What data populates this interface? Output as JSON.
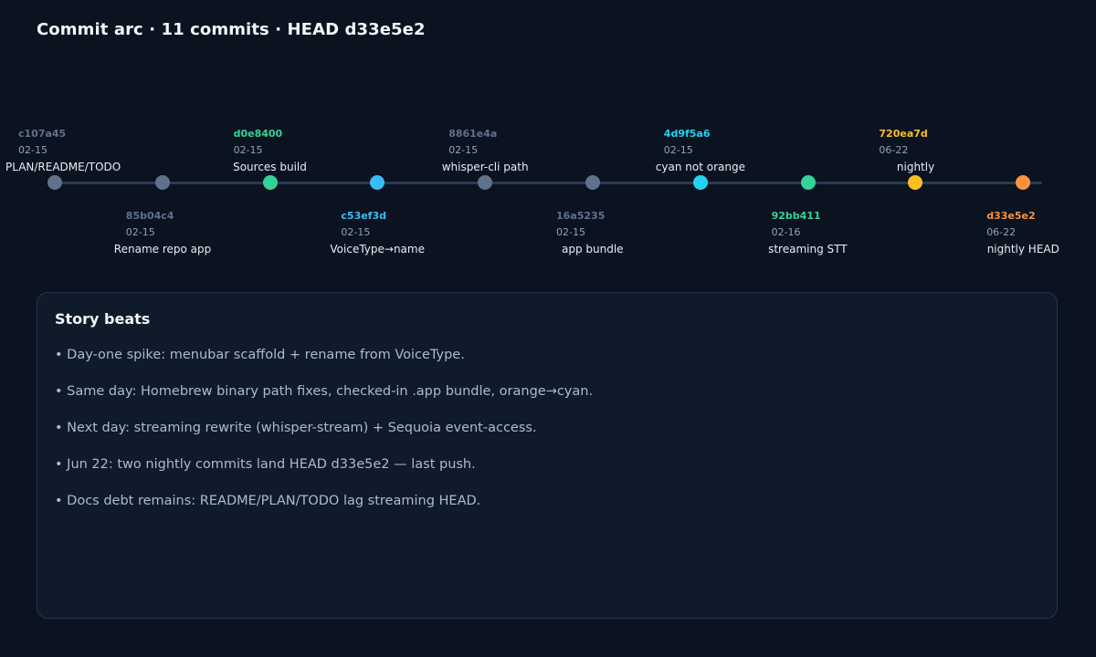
{
  "header": {
    "title": "Commit arc · 11 commits · HEAD d33e5e2"
  },
  "commits": [
    {
      "hash": "c107a45",
      "date": "02-15",
      "label": "PLAN/README/TODO",
      "position": "above",
      "color": "#5f728c"
    },
    {
      "hash": "85b04c4",
      "date": "02-15",
      "label": "Rename repo app",
      "position": "below",
      "color": "#5f728c"
    },
    {
      "hash": "d0e8400",
      "date": "02-15",
      "label": "Sources build",
      "position": "above",
      "color": "#34d399"
    },
    {
      "hash": "c53ef3d",
      "date": "02-15",
      "label": "VoiceType→name",
      "position": "below",
      "color": "#38bdf8"
    },
    {
      "hash": "8861e4a",
      "date": "02-15",
      "label": "whisper-cli path",
      "position": "above",
      "color": "#5f728c"
    },
    {
      "hash": "16a5235",
      "date": "02-15",
      "label": "app bundle",
      "position": "below",
      "color": "#5f728c"
    },
    {
      "hash": "4d9f5a6",
      "date": "02-15",
      "label": "cyan not orange",
      "position": "above",
      "color": "#22d3ee"
    },
    {
      "hash": "92bb411",
      "date": "02-16",
      "label": "streaming STT",
      "position": "below",
      "color": "#34d399"
    },
    {
      "hash": "720ea7d",
      "date": "06-22",
      "label": "nightly",
      "position": "above",
      "color": "#fbbf24"
    },
    {
      "hash": "d33e5e2",
      "date": "06-22",
      "label": "nightly HEAD",
      "position": "below",
      "color": "#fb923c"
    }
  ],
  "story": {
    "title": "Story beats",
    "beats": [
      "• Day-one spike: menubar scaffold + rename from VoiceType.",
      "• Same day: Homebrew binary path fixes, checked-in .app bundle, orange→cyan.",
      "• Next day: streaming rewrite (whisper-stream) + Sequoia event-access.",
      "• Jun 22: two nightly commits land HEAD d33e5e2 — last push.",
      "• Docs debt remains: README/PLAN/TODO lag streaming HEAD."
    ]
  }
}
